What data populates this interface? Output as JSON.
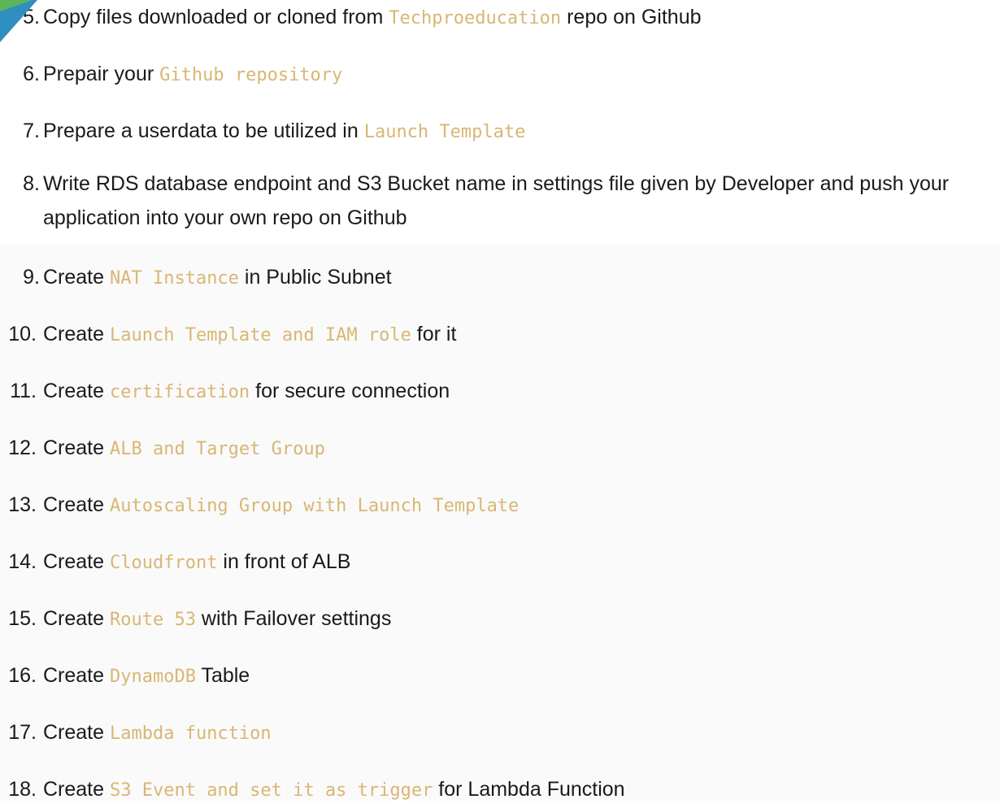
{
  "colors": {
    "code_text": "#d8b774",
    "body_text": "#1a1a1a",
    "top_band": "#ffffff",
    "bottom_band": "#fafafa"
  },
  "steps": [
    {
      "num": "5.",
      "pre": "Copy files downloaded or cloned from ",
      "code": "Techproeducation",
      "post": " repo on Github"
    },
    {
      "num": "6.",
      "pre": "Prepair your ",
      "code": "Github repository",
      "post": ""
    },
    {
      "num": "7.",
      "pre": "Prepare a userdata to be utilized in ",
      "code": "Launch Template",
      "post": ""
    },
    {
      "num": "8.",
      "pre": "Write RDS database endpoint and S3 Bucket name in settings file given by Developer and push your application into your own repo on Github",
      "code": "",
      "post": ""
    },
    {
      "num": "9.",
      "pre": "Create ",
      "code": "NAT Instance",
      "post": " in Public Subnet"
    },
    {
      "num": "10.",
      "pre": "Create ",
      "code": "Launch Template and IAM role",
      "post": " for it"
    },
    {
      "num": "11.",
      "pre": "Create ",
      "code": "certification",
      "post": " for secure connection"
    },
    {
      "num": "12.",
      "pre": "Create ",
      "code": "ALB and Target Group",
      "post": ""
    },
    {
      "num": "13.",
      "pre": "Create ",
      "code": "Autoscaling Group with Launch Template",
      "post": ""
    },
    {
      "num": "14.",
      "pre": "Create ",
      "code": "Cloudfront",
      "post": " in front of ALB"
    },
    {
      "num": "15.",
      "pre": "Create ",
      "code": "Route 53",
      "post": " with Failover settings"
    },
    {
      "num": "16.",
      "pre": "Create ",
      "code": "DynamoDB",
      "post": " Table"
    },
    {
      "num": "17.",
      "pre": "Create ",
      "code": "Lambda function",
      "post": ""
    },
    {
      "num": "18.",
      "pre": "Create ",
      "code": "S3 Event and set it as trigger",
      "post": " for Lambda Function"
    }
  ]
}
